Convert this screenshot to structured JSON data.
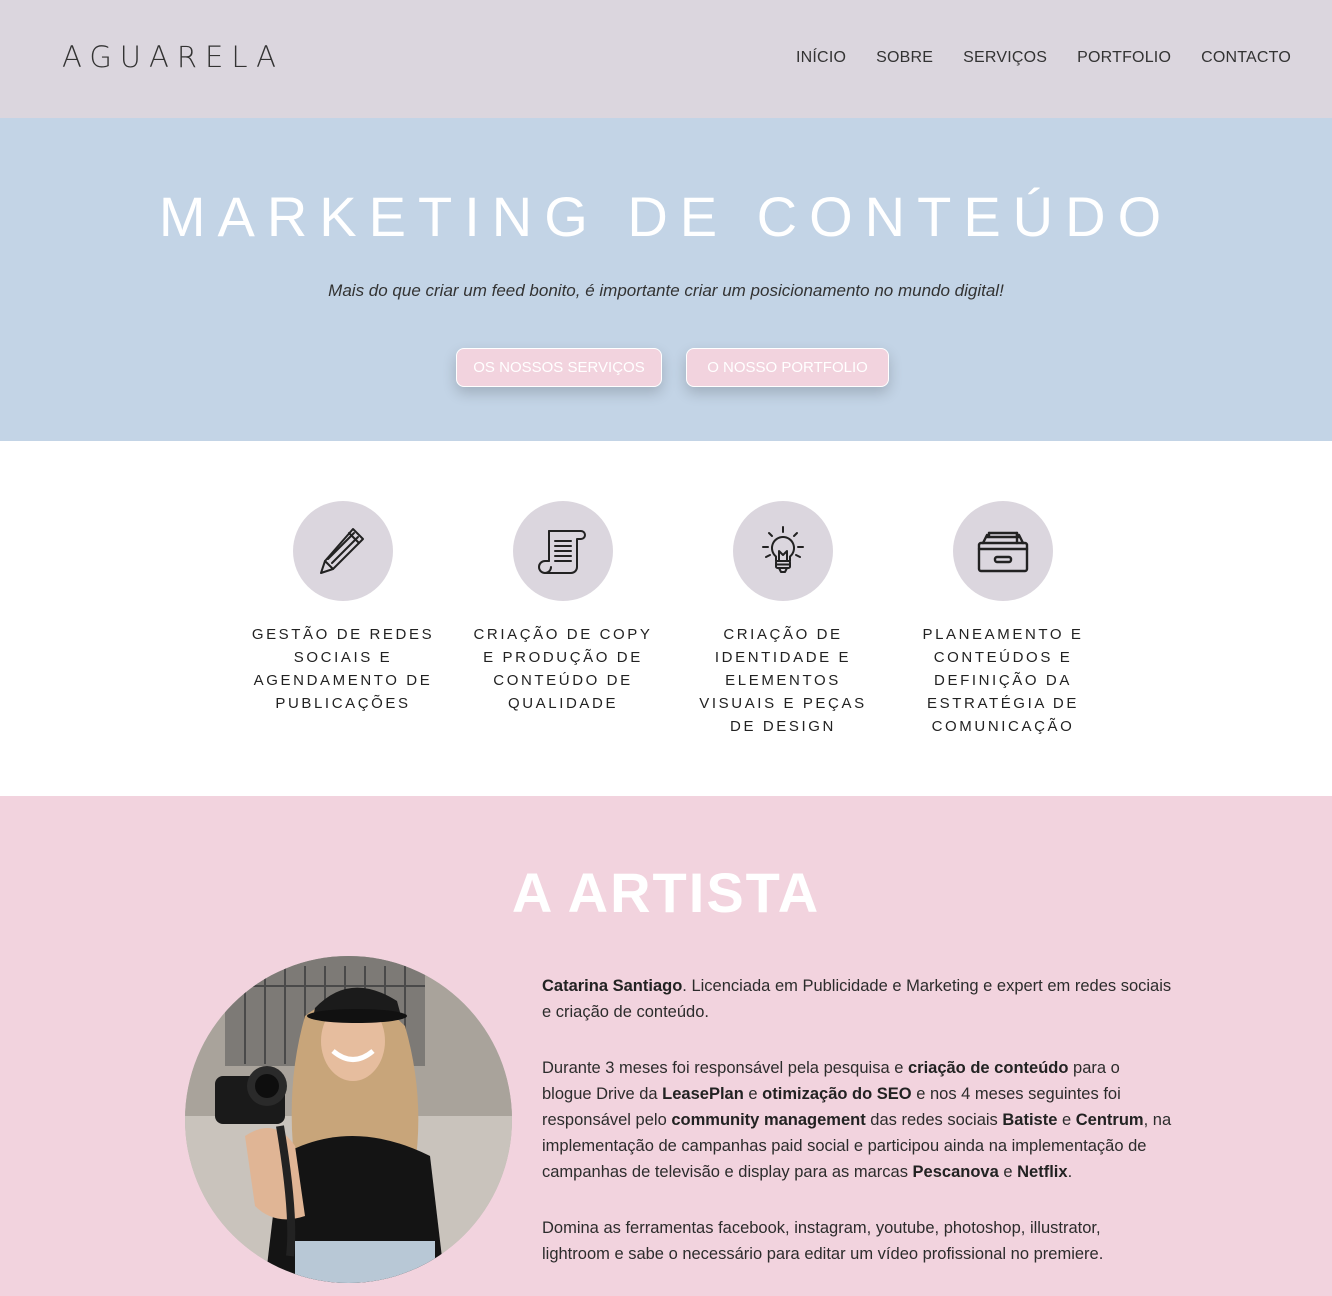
{
  "header": {
    "logo": "AGUARELA",
    "nav": [
      "INÍCIO",
      "SOBRE",
      "SERVIÇOS",
      "PORTFOLIO",
      "CONTACTO"
    ]
  },
  "hero": {
    "title": "MARKETING DE CONTEÚDO",
    "subtitle": "Mais do que criar um feed bonito, é importante criar um posicionamento no mundo digital!",
    "buttons": [
      "OS NOSSOS SERVIÇOS",
      "O NOSSO PORTFOLIO"
    ]
  },
  "services": [
    {
      "icon": "pencil-icon",
      "label": "GESTÃO DE REDES SOCIAIS E AGENDAMENTO DE PUBLICAÇÕES"
    },
    {
      "icon": "scroll-icon",
      "label": "CRIAÇÃO DE COPY E PRODUÇÃO DE CONTEÚDO DE QUALIDADE"
    },
    {
      "icon": "lightbulb-icon",
      "label": "CRIAÇÃO DE IDENTIDADE E ELEMENTOS VISUAIS E PEÇAS DE DESIGN"
    },
    {
      "icon": "archive-box-icon",
      "label": "PLANEAMENTO E CONTEÚDOS E DEFINIÇÃO DA ESTRATÉGIA DE COMUNICAÇÃO"
    }
  ],
  "artist": {
    "title": "A ARTISTA",
    "p1": {
      "name": "Catarina Santiago",
      "text": ". Licenciada em Publicidade e Marketing e expert em redes sociais e criação de conteúdo."
    },
    "p2": {
      "t1": "Durante 3 meses foi responsável pela pesquisa e ",
      "b1": "criação de conteúdo",
      "t2": " para o blogue Drive da ",
      "b2": "LeasePlan",
      "t3": " e ",
      "b3": "otimização do SEO",
      "t4": " e nos 4 meses seguintes foi responsável pelo ",
      "b4": "community management",
      "t5": " das redes sociais ",
      "b5": "Batiste",
      "t6": " e ",
      "b6": "Centrum",
      "t7": ", na implementação de campanhas paid social e participou ainda na implementação de campanhas de televisão e display para as marcas ",
      "b7": "Pescanova",
      "t8": " e ",
      "b8": "Netflix",
      "t9": "."
    },
    "p3": "Domina as ferramentas facebook, instagram, youtube, photoshop, illustrator, lightroom e sabe o necessário para editar um vídeo profissional no premiere."
  },
  "colors": {
    "header_bg": "#dbd6de",
    "hero_bg": "#c3d4e6",
    "button_bg": "#f2d3de",
    "artist_bg": "#f2d3de",
    "icon_circle": "#dbd6de"
  }
}
